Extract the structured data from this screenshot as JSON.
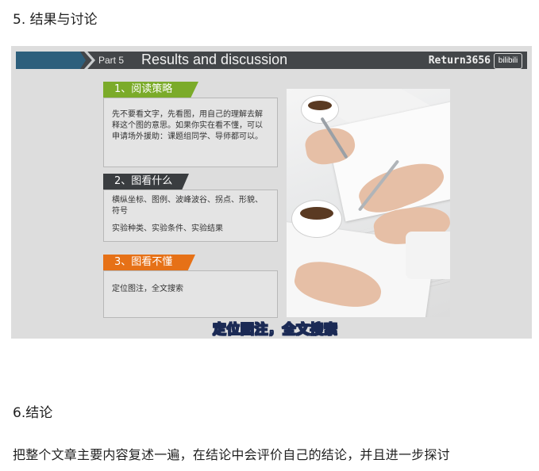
{
  "heading5": "5. 结果与讨论",
  "slide": {
    "part": "Part 5",
    "title": "Results and discussion",
    "brand": "Return3656",
    "logo": "bilibili",
    "sections": [
      {
        "tag": "1、阅读策略",
        "body": "先不要看文字，先看图，用自己的理解去解释这个图的意思。如果你实在看不懂，可以申请场外援助：课题组同学、导师都可以。",
        "color": "#7bab2a"
      },
      {
        "tag": "2、图看什么",
        "body_lines": [
          "横纵坐标、图例、波峰波谷、拐点、形貌、符号",
          "实验种类、实验条件、实验结果"
        ],
        "color": "#3a3d40"
      },
      {
        "tag": "3、图看不懂",
        "body": "定位图注，全文搜索",
        "color": "#e67117"
      }
    ],
    "subtitle": "定位图注，全文搜索"
  },
  "heading6": "6.结论",
  "paragraph": "把整个文章主要内容复述一遍，在结论中会评价自己的结论，并且进一步探讨"
}
